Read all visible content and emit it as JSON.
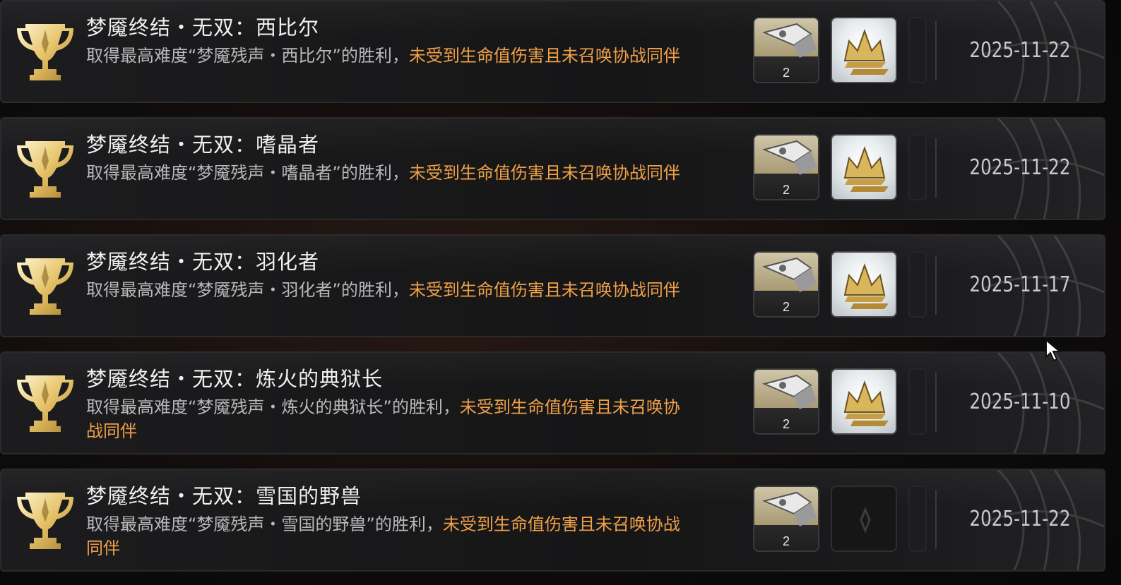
{
  "achievements": [
    {
      "title": "梦魇终结・无双：西比尔",
      "desc_plain": "取得最高难度“梦魇残声・西比尔”的胜利，",
      "desc_highlight": "未受到生命值伤害且未召唤协战同伴",
      "reward_qty": "2",
      "crown_unlocked": true,
      "date": "2025-11-22"
    },
    {
      "title": "梦魇终结・无双：嗜晶者",
      "desc_plain": "取得最高难度“梦魇残声・嗜晶者”的胜利，",
      "desc_highlight": "未受到生命值伤害且未召唤协战同伴",
      "reward_qty": "2",
      "crown_unlocked": true,
      "date": "2025-11-22"
    },
    {
      "title": "梦魇终结・无双：羽化者",
      "desc_plain": "取得最高难度“梦魇残声・羽化者”的胜利，",
      "desc_highlight": "未受到生命值伤害且未召唤协战同伴",
      "reward_qty": "2",
      "crown_unlocked": true,
      "date": "2025-11-17"
    },
    {
      "title": "梦魇终结・无双：炼火的典狱长",
      "desc_plain": "取得最高难度“梦魇残声・炼火的典狱长”的胜利，",
      "desc_highlight": "未受到生命值伤害且未召唤协战同伴",
      "reward_qty": "2",
      "crown_unlocked": true,
      "date": "2025-11-10"
    },
    {
      "title": "梦魇终结・无双：雪国的野兽",
      "desc_plain": "取得最高难度“梦魇残声・雪国的野兽”的胜利，",
      "desc_highlight": "未受到生命值伤害且未召唤协战同伴",
      "reward_qty": "2",
      "crown_unlocked": false,
      "date": "2025-11-22"
    }
  ],
  "icons": {
    "trophy": "trophy-icon",
    "material": "material-reward-icon",
    "crown": "crown-reward-icon",
    "cursor": "mouse-cursor-icon"
  },
  "colors": {
    "highlight": "#f0a048",
    "title": "#f0f0f0",
    "desc": "#b9b9bb",
    "gold": "#e6c46a"
  }
}
